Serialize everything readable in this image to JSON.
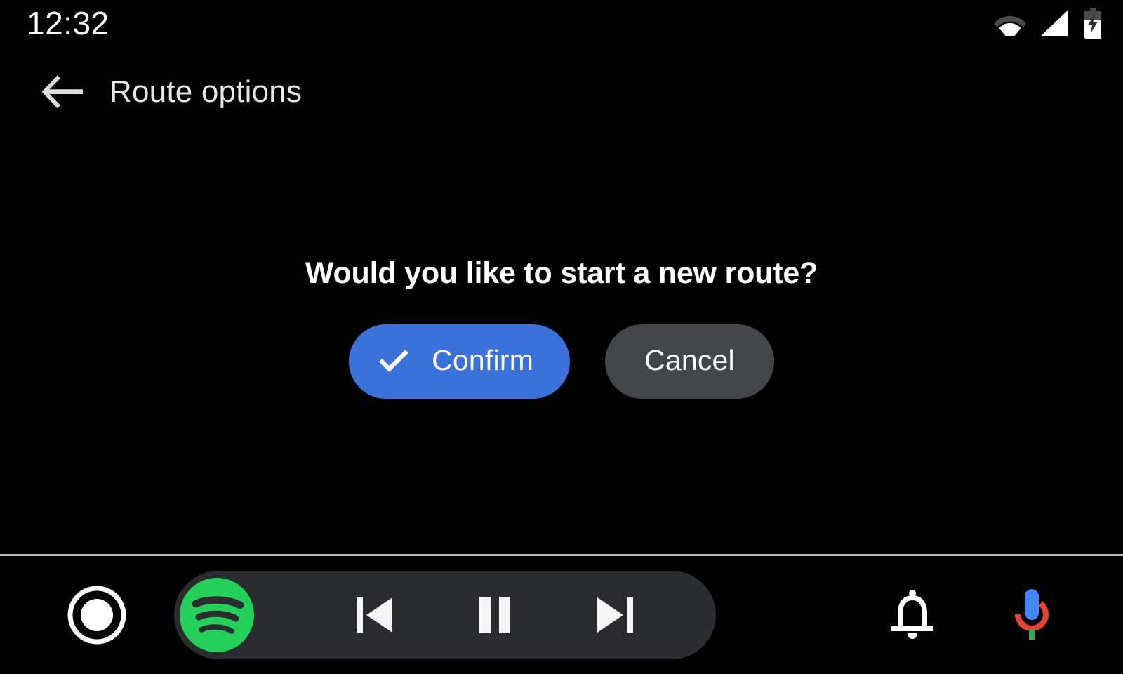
{
  "status_bar": {
    "time": "12:32",
    "icons": [
      {
        "name": "wifi-icon",
        "state": "partial"
      },
      {
        "name": "cellular-signal-icon",
        "state": "full"
      },
      {
        "name": "battery-charging-icon",
        "state": "charging"
      }
    ]
  },
  "app_bar": {
    "back_icon": "arrow-left-icon",
    "title": "Route options"
  },
  "dialog": {
    "message": "Would you like to start a new route?",
    "confirm_label": "Confirm",
    "confirm_icon": "check-icon",
    "cancel_label": "Cancel"
  },
  "nav_bar": {
    "home_icon": "home-circle-icon",
    "media_app_icon": "spotify-icon",
    "media_controls": [
      {
        "name": "skip-previous-icon",
        "label": "Previous"
      },
      {
        "name": "pause-icon",
        "label": "Pause"
      },
      {
        "name": "skip-next-icon",
        "label": "Next"
      }
    ],
    "notifications_icon": "bell-icon",
    "assistant_icon": "google-assistant-mic-icon"
  },
  "colors": {
    "background": "#000000",
    "confirm_blue": "#3B72D9",
    "cancel_gray": "#434649",
    "media_pill": "#2A2C2F",
    "spotify_green": "#24CF5A",
    "divider": "#b9b9b9",
    "assistant_blue": "#4285F4",
    "assistant_red": "#EA4335",
    "assistant_yellow": "#FBBC05",
    "assistant_green": "#34A853"
  }
}
